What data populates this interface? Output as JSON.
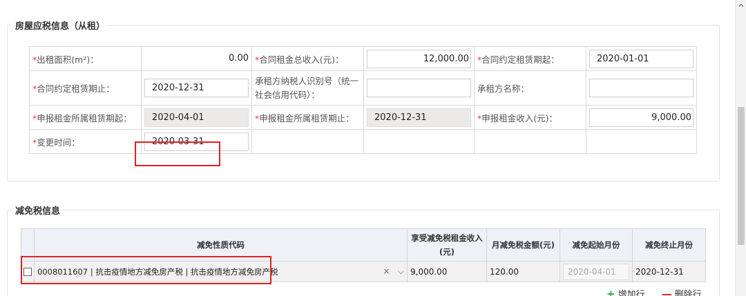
{
  "section1": {
    "title": "房屋应税信息（从租）",
    "required_mark": "*",
    "fields": {
      "rent_area_label": "出租面积(m²)：",
      "rent_area_value": "0.00",
      "total_rent_label": "合同租金总收入(元)：",
      "total_rent_value": "12,000.00",
      "lease_start_label": "合同约定租赁期起：",
      "lease_start_value": "2020-01-01",
      "lease_end_label": "合同约定租赁期止：",
      "lease_end_value": "2020-12-31",
      "lessee_taxid_label": "承租方纳税人识别号（统一社会信用代码）：",
      "lessee_taxid_value": "",
      "lessee_name_label": "承租方名称：",
      "lessee_name_value": "",
      "declared_start_label": "申报租金所属租赁期起：",
      "declared_start_value": "2020-04-01",
      "declared_end_label": "申报租金所属租赁期止：",
      "declared_end_value": "2020-12-31",
      "declared_income_label": "申报租金收入(元)：",
      "declared_income_value": "9,000.00",
      "change_time_label": "变更时间：",
      "change_time_value": "2020-03-31"
    }
  },
  "section2": {
    "title": "减免税信息",
    "headers": [
      "减免性质代码",
      "享受减免税租金收入(元)",
      "月减免税金额(元)",
      "减免起始月份",
      "减免终止月份"
    ],
    "rows": [
      {
        "code": "0008011607 | 抗击疫情地方减免房产税 | 抗击疫情地方减免房产税",
        "clear": "×",
        "dropdown": "⌵",
        "income": "9,000.00",
        "monthly": "120.00",
        "start_month": "2020-04-01",
        "end_month": "2020-12-31"
      }
    ],
    "add_row": "增加行",
    "delete_row": "删除行"
  },
  "scroll": {
    "up_arrow": "^"
  }
}
